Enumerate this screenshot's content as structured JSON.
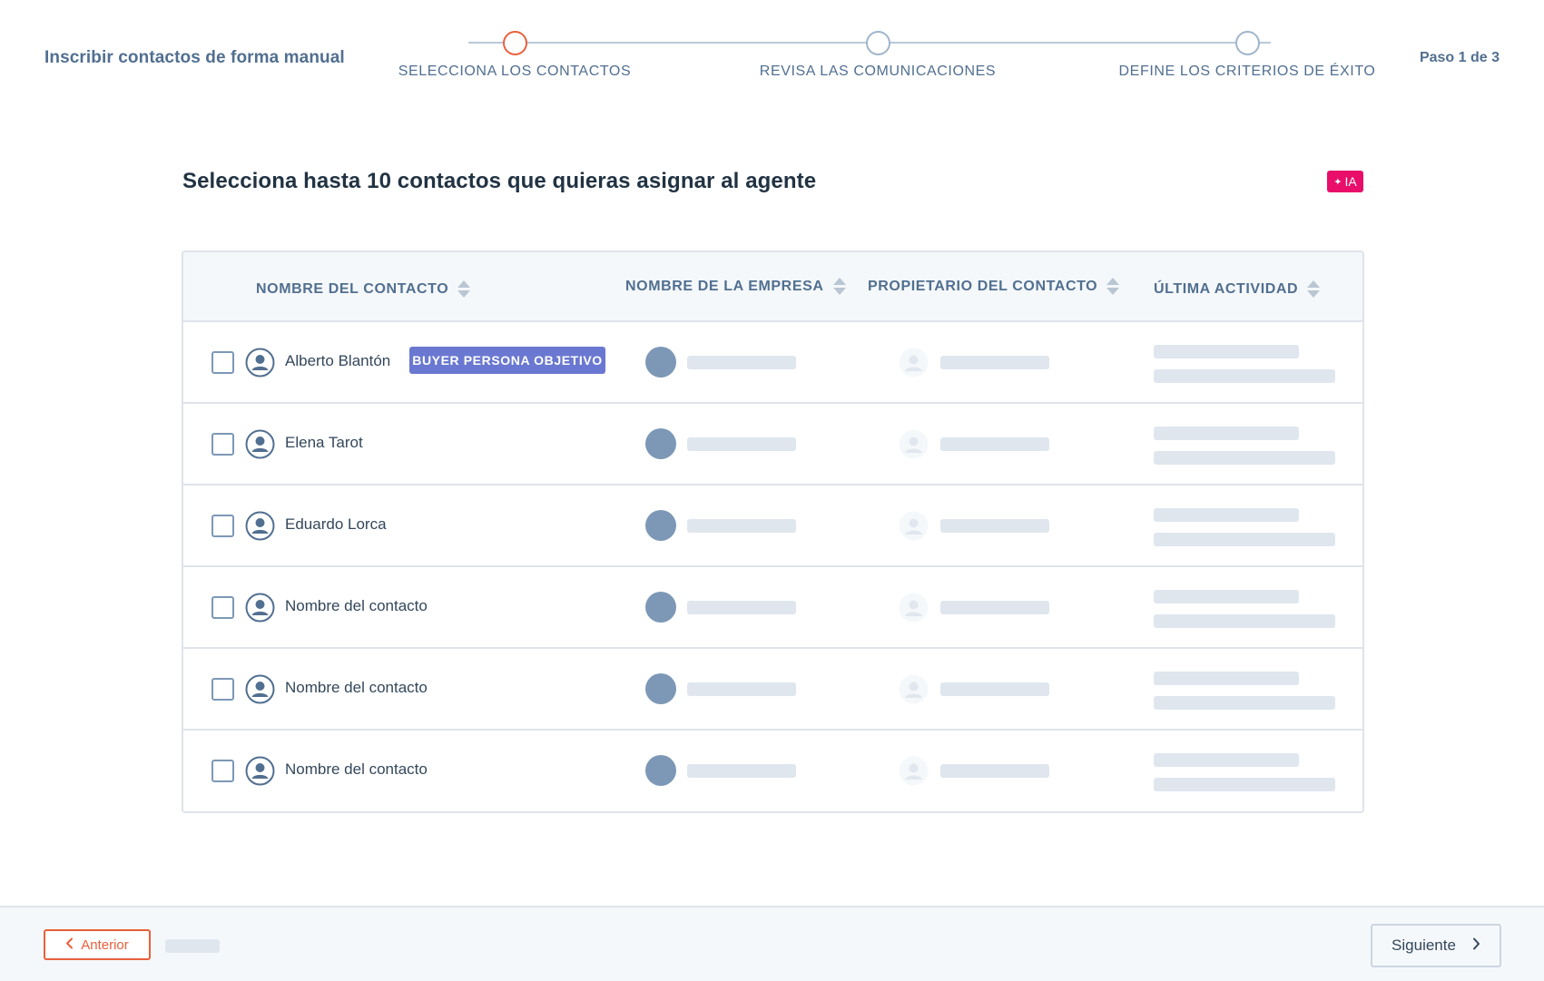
{
  "header": {
    "title": "Inscribir contactos de forma manual",
    "step_count": "Paso 1 de 3",
    "steps": [
      {
        "label": "SELECCIONA LOS CONTACTOS",
        "active": true
      },
      {
        "label": "REVISA LAS COMUNICACIONES",
        "active": false
      },
      {
        "label": "DEFINE LOS CRITERIOS DE ÉXITO",
        "active": false
      }
    ]
  },
  "main": {
    "heading": "Selecciona hasta 10 contactos que quieras asignar al agente",
    "ai_badge": "IA"
  },
  "table": {
    "columns": [
      "NOMBRE DEL CONTACTO",
      "NOMBRE DE LA EMPRESA",
      "PROPIETARIO DEL CONTACTO",
      "ÚLTIMA ACTIVIDAD"
    ],
    "rows": [
      {
        "name": "Alberto Blantón",
        "tag": "BUYER PERSONA OBJETIVO"
      },
      {
        "name": "Elena Tarot"
      },
      {
        "name": "Eduardo Lorca"
      },
      {
        "name": "Nombre del contacto"
      },
      {
        "name": "Nombre del contacto"
      },
      {
        "name": "Nombre del contacto"
      }
    ]
  },
  "footer": {
    "prev_label": "Anterior",
    "next_label": "Siguiente"
  },
  "colors": {
    "accent": "#e8603c",
    "persona_tag": "#6a78d1",
    "ai_badge": "#e80e6a",
    "text_primary": "#33475b",
    "text_secondary": "#516f90"
  }
}
